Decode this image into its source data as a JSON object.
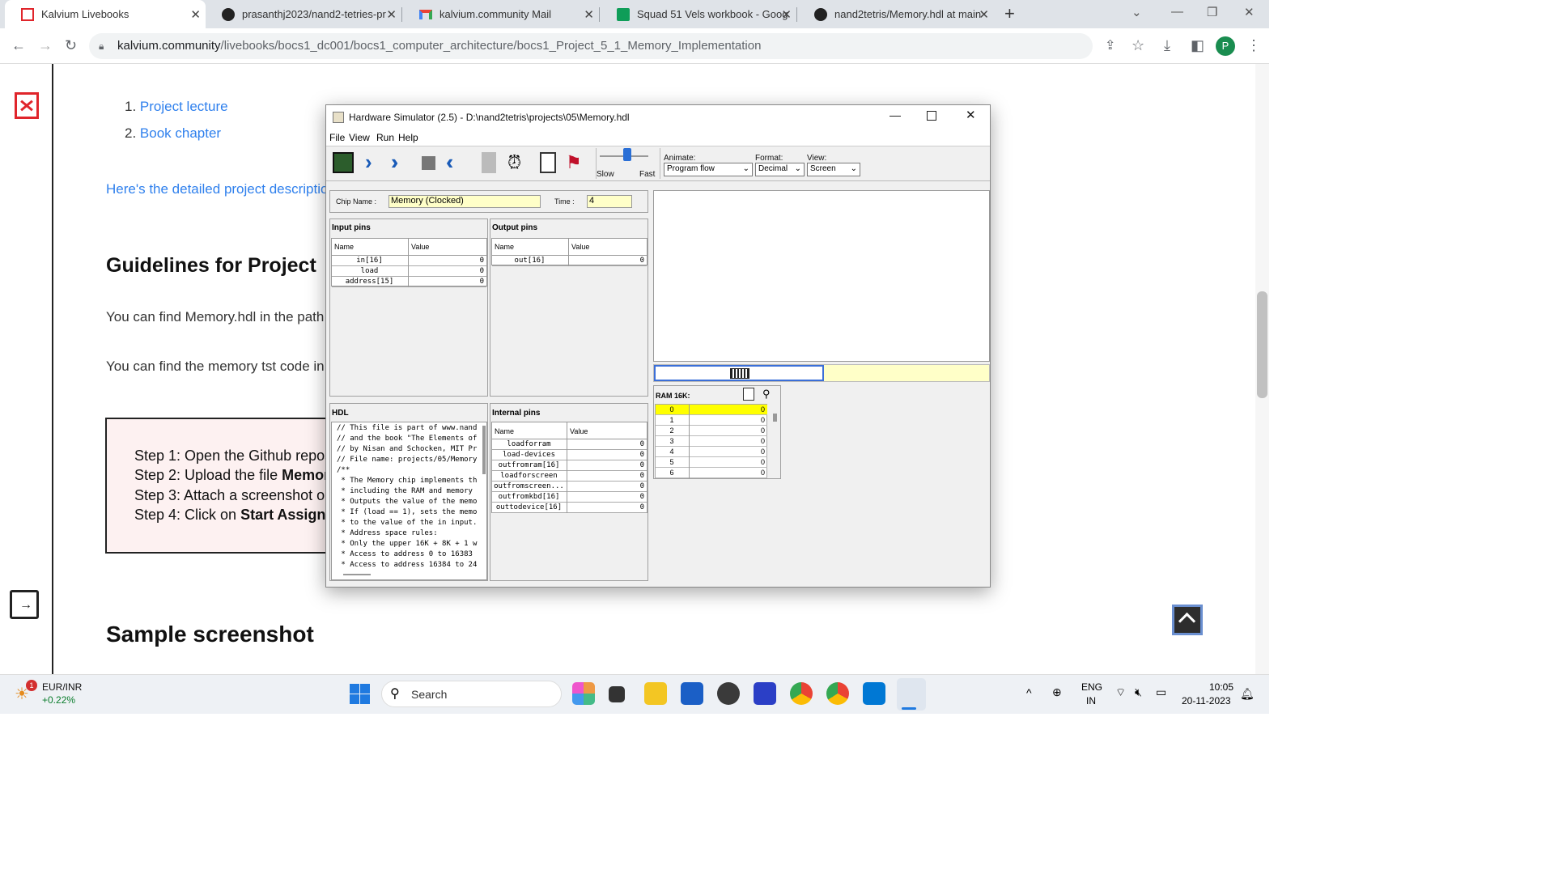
{
  "browser": {
    "tabs": [
      {
        "title": "Kalvium Livebooks",
        "icon": "kalvium-icon",
        "active": true
      },
      {
        "title": "prasanthj2023/nand2-tetries-pr",
        "icon": "github-icon"
      },
      {
        "title": "kalvium.community Mail",
        "icon": "gmail-icon"
      },
      {
        "title": "Squad 51 Vels workbook - Goog",
        "icon": "sheets-icon"
      },
      {
        "title": "nand2tetris/Memory.hdl at main",
        "icon": "github-icon"
      }
    ],
    "url_host": "kalvium.community",
    "url_path": "/livebooks/bocs1_dc001/bocs1_computer_architecture/bocs1_Project_5_1_Memory_Implementation",
    "profile_initial": "P"
  },
  "page": {
    "list": [
      {
        "num": "1.",
        "text": "Project lecture"
      },
      {
        "num": "2.",
        "text": "Book chapter"
      }
    ],
    "description_link": "Here's the detailed project description",
    "guidelines_heading": "Guidelines for Project",
    "para1": "You can find Memory.hdl in the path n",
    "para2": "You can find the memory tst code in th",
    "steps": [
      {
        "prefix": "Step 1: Open the Github repos",
        "bold": ""
      },
      {
        "prefix": "Step 2: Upload the file ",
        "bold": "Memor"
      },
      {
        "prefix": "Step 3: Attach a screenshot o",
        "bold": ""
      },
      {
        "prefix": "Step 4: Click on ",
        "bold": "Start Assignn"
      }
    ],
    "sample_heading": "Sample screenshot"
  },
  "simulator": {
    "title": "Hardware Simulator (2.5) - D:\\nand2tetris\\projects\\05\\Memory.hdl",
    "menu": [
      "File",
      "View",
      "Run",
      "Help"
    ],
    "speed_slow": "Slow",
    "speed_fast": "Fast",
    "animate_label": "Animate:",
    "animate_value": "Program flow",
    "format_label": "Format:",
    "format_value": "Decimal",
    "view_label": "View:",
    "view_value": "Screen",
    "chip_name_label": "Chip Name :",
    "chip_name_value": "Memory (Clocked)",
    "time_label": "Time :",
    "time_value": "4",
    "input_pins_title": "Input pins",
    "output_pins_title": "Output pins",
    "internal_pins_title": "Internal pins",
    "hdl_title": "HDL",
    "col_name": "Name",
    "col_value": "Value",
    "input_pins": [
      {
        "name": "in[16]",
        "value": "0"
      },
      {
        "name": "load",
        "value": "0"
      },
      {
        "name": "address[15]",
        "value": "0"
      }
    ],
    "output_pins": [
      {
        "name": "out[16]",
        "value": "0"
      }
    ],
    "internal_pins": [
      {
        "name": "loadforram",
        "value": "0"
      },
      {
        "name": "load-devices",
        "value": "0"
      },
      {
        "name": "outfromram[16]",
        "value": "0"
      },
      {
        "name": "loadforscreen",
        "value": "0"
      },
      {
        "name": "outfromscreen...",
        "value": "0"
      },
      {
        "name": "outfromkbd[16]",
        "value": "0"
      },
      {
        "name": "outtodevice[16]",
        "value": "0"
      }
    ],
    "hdl_lines": [
      "// This file is part of www.nand",
      "// and the book \"The Elements of",
      "// by Nisan and Schocken, MIT Pr",
      "// File name: projects/05/Memory",
      "/**",
      " * The Memory chip implements th",
      " * including the RAM and memory",
      " * Outputs the value of the memo",
      " * If (load == 1), sets the memo",
      " * to the value of the in input.",
      " * Address space rules:",
      " * Only the upper 16K + 8K + 1 w",
      " * Access to address 0 to 16383",
      " * Access to address 16384 to 24"
    ],
    "ram_title": "RAM 16K:",
    "ram": [
      {
        "addr": "0",
        "value": "0"
      },
      {
        "addr": "1",
        "value": "0"
      },
      {
        "addr": "2",
        "value": "0"
      },
      {
        "addr": "3",
        "value": "0"
      },
      {
        "addr": "4",
        "value": "0"
      },
      {
        "addr": "5",
        "value": "0"
      },
      {
        "addr": "6",
        "value": "0"
      }
    ]
  },
  "taskbar": {
    "ticker_name": "EUR/INR",
    "ticker_change": "+0.22%",
    "ticker_badge": "1",
    "search_placeholder": "Search",
    "lang_line1": "ENG",
    "lang_line2": "IN",
    "time": "10:05",
    "date": "20-11-2023"
  }
}
